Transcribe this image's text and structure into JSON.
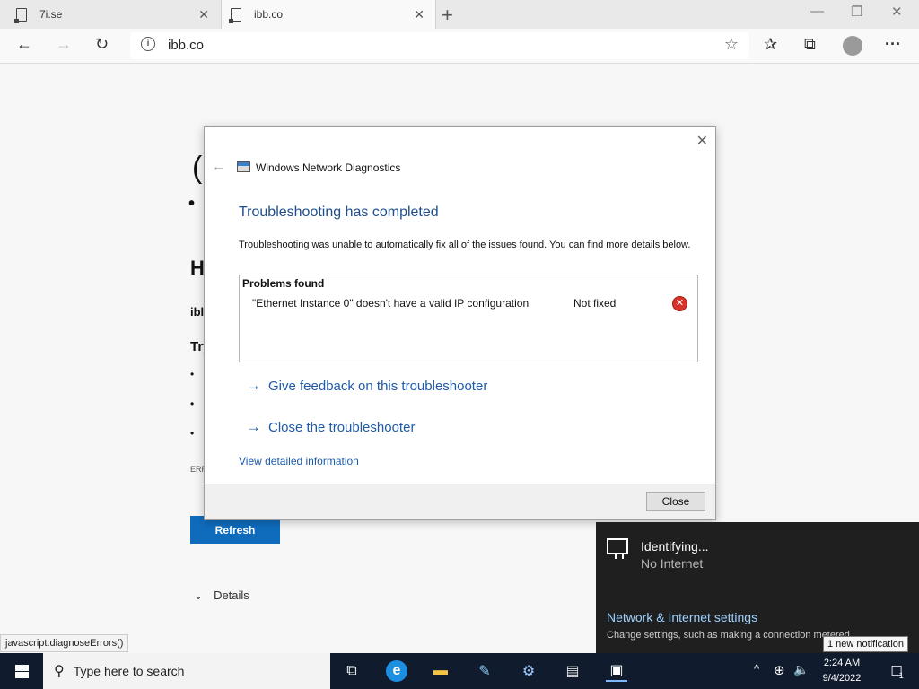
{
  "browser": {
    "tabs": [
      {
        "title": "7i.se",
        "close": "✕"
      },
      {
        "title": "ibb.co",
        "close": "✕"
      }
    ],
    "new_tab": "+",
    "window_controls": {
      "minimize": "—",
      "restore": "❐",
      "close": "✕"
    },
    "toolbar": {
      "back": "←",
      "forward": "→",
      "refresh": "↻",
      "favorites": "✰",
      "collections": "⧉",
      "more": "···"
    },
    "address": {
      "url": "ibb.co",
      "info_icon": "i",
      "star": "☆"
    }
  },
  "page": {
    "bg_glyph_1": "(",
    "bg_glyph_2": "•",
    "bg_heading": "H",
    "bg_bold": "ibl",
    "bg_try": "Try",
    "bullets": [
      "•",
      "•",
      "•"
    ],
    "err_prefix": "ERR",
    "refresh_label": "Refresh",
    "details_label": "Details",
    "details_chevron": "⌄",
    "status_url": "javascript:diagnoseErrors()"
  },
  "dialog": {
    "close": "✕",
    "back": "←",
    "app_title": "Windows Network Diagnostics",
    "heading": "Troubleshooting has completed",
    "description": "Troubleshooting was unable to automatically fix all of the issues found. You can find more details below.",
    "problems_header": "Problems found",
    "problems": [
      {
        "name": "\"Ethernet Instance 0\" doesn't have a valid IP configuration",
        "status": "Not fixed",
        "icon": "✕"
      }
    ],
    "links": [
      {
        "arrow": "→",
        "label": "Give feedback on this troubleshooter"
      },
      {
        "arrow": "→",
        "label": "Close the troubleshooter"
      }
    ],
    "detail_link": "View detailed information",
    "close_button": "Close"
  },
  "network": {
    "status": "Identifying...",
    "substatus": "No Internet",
    "settings_title": "Network & Internet settings",
    "settings_sub": "Change settings, such as making a connection metered."
  },
  "notification_tip": "1 new notification",
  "taskbar": {
    "search_placeholder": "Type here to search",
    "search_icon": "⚲",
    "apps": [
      {
        "name": "task-view",
        "glyph": "⧉"
      },
      {
        "name": "edge",
        "glyph": "e"
      },
      {
        "name": "file-explorer",
        "glyph": "▬"
      },
      {
        "name": "paint",
        "glyph": "✎"
      },
      {
        "name": "settings",
        "glyph": "⚙"
      },
      {
        "name": "server-manager",
        "glyph": "▤"
      },
      {
        "name": "network-diagnostics",
        "glyph": "▣"
      }
    ],
    "tray": {
      "chevron": "^",
      "network": "⊕",
      "volume": "🔈"
    },
    "time": "2:24 AM",
    "date": "9/4/2022",
    "action_center": "☐",
    "notification_count": "1"
  },
  "colors": {
    "dialog_heading": "#1e4e8c",
    "link": "#1e5aa8",
    "refresh_button": "#0f6cbd",
    "error_icon": "#d9342b",
    "taskbar": "#101b2d",
    "flyout": "#1f1f1f"
  }
}
